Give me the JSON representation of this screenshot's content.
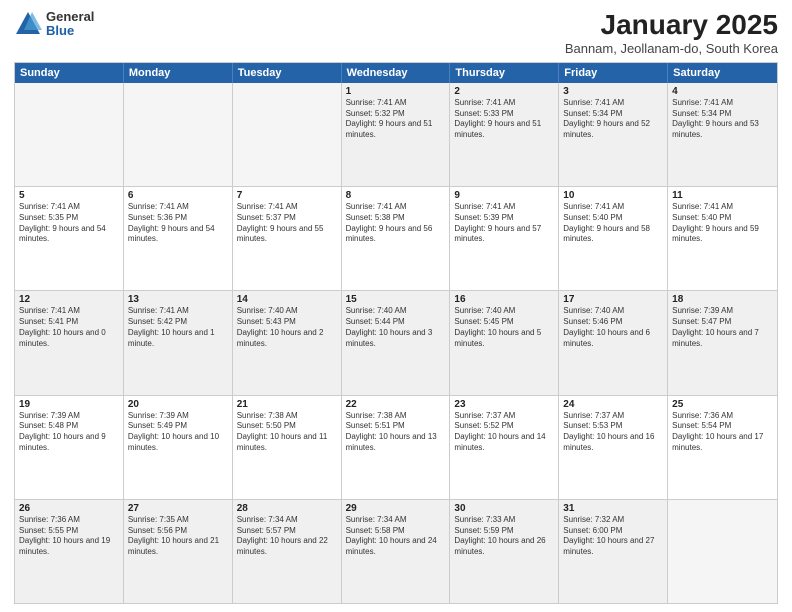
{
  "header": {
    "logo_general": "General",
    "logo_blue": "Blue",
    "title": "January 2025",
    "location": "Bannam, Jeollanam-do, South Korea"
  },
  "weekdays": [
    "Sunday",
    "Monday",
    "Tuesday",
    "Wednesday",
    "Thursday",
    "Friday",
    "Saturday"
  ],
  "rows": [
    [
      {
        "day": "",
        "empty": true
      },
      {
        "day": "",
        "empty": true
      },
      {
        "day": "",
        "empty": true
      },
      {
        "day": "1",
        "sunrise": "7:41 AM",
        "sunset": "5:32 PM",
        "daylight": "9 hours and 51 minutes."
      },
      {
        "day": "2",
        "sunrise": "7:41 AM",
        "sunset": "5:33 PM",
        "daylight": "9 hours and 51 minutes."
      },
      {
        "day": "3",
        "sunrise": "7:41 AM",
        "sunset": "5:34 PM",
        "daylight": "9 hours and 52 minutes."
      },
      {
        "day": "4",
        "sunrise": "7:41 AM",
        "sunset": "5:34 PM",
        "daylight": "9 hours and 53 minutes."
      }
    ],
    [
      {
        "day": "5",
        "sunrise": "7:41 AM",
        "sunset": "5:35 PM",
        "daylight": "9 hours and 54 minutes."
      },
      {
        "day": "6",
        "sunrise": "7:41 AM",
        "sunset": "5:36 PM",
        "daylight": "9 hours and 54 minutes."
      },
      {
        "day": "7",
        "sunrise": "7:41 AM",
        "sunset": "5:37 PM",
        "daylight": "9 hours and 55 minutes."
      },
      {
        "day": "8",
        "sunrise": "7:41 AM",
        "sunset": "5:38 PM",
        "daylight": "9 hours and 56 minutes."
      },
      {
        "day": "9",
        "sunrise": "7:41 AM",
        "sunset": "5:39 PM",
        "daylight": "9 hours and 57 minutes."
      },
      {
        "day": "10",
        "sunrise": "7:41 AM",
        "sunset": "5:40 PM",
        "daylight": "9 hours and 58 minutes."
      },
      {
        "day": "11",
        "sunrise": "7:41 AM",
        "sunset": "5:40 PM",
        "daylight": "9 hours and 59 minutes."
      }
    ],
    [
      {
        "day": "12",
        "sunrise": "7:41 AM",
        "sunset": "5:41 PM",
        "daylight": "10 hours and 0 minutes."
      },
      {
        "day": "13",
        "sunrise": "7:41 AM",
        "sunset": "5:42 PM",
        "daylight": "10 hours and 1 minute."
      },
      {
        "day": "14",
        "sunrise": "7:40 AM",
        "sunset": "5:43 PM",
        "daylight": "10 hours and 2 minutes."
      },
      {
        "day": "15",
        "sunrise": "7:40 AM",
        "sunset": "5:44 PM",
        "daylight": "10 hours and 3 minutes."
      },
      {
        "day": "16",
        "sunrise": "7:40 AM",
        "sunset": "5:45 PM",
        "daylight": "10 hours and 5 minutes."
      },
      {
        "day": "17",
        "sunrise": "7:40 AM",
        "sunset": "5:46 PM",
        "daylight": "10 hours and 6 minutes."
      },
      {
        "day": "18",
        "sunrise": "7:39 AM",
        "sunset": "5:47 PM",
        "daylight": "10 hours and 7 minutes."
      }
    ],
    [
      {
        "day": "19",
        "sunrise": "7:39 AM",
        "sunset": "5:48 PM",
        "daylight": "10 hours and 9 minutes."
      },
      {
        "day": "20",
        "sunrise": "7:39 AM",
        "sunset": "5:49 PM",
        "daylight": "10 hours and 10 minutes."
      },
      {
        "day": "21",
        "sunrise": "7:38 AM",
        "sunset": "5:50 PM",
        "daylight": "10 hours and 11 minutes."
      },
      {
        "day": "22",
        "sunrise": "7:38 AM",
        "sunset": "5:51 PM",
        "daylight": "10 hours and 13 minutes."
      },
      {
        "day": "23",
        "sunrise": "7:37 AM",
        "sunset": "5:52 PM",
        "daylight": "10 hours and 14 minutes."
      },
      {
        "day": "24",
        "sunrise": "7:37 AM",
        "sunset": "5:53 PM",
        "daylight": "10 hours and 16 minutes."
      },
      {
        "day": "25",
        "sunrise": "7:36 AM",
        "sunset": "5:54 PM",
        "daylight": "10 hours and 17 minutes."
      }
    ],
    [
      {
        "day": "26",
        "sunrise": "7:36 AM",
        "sunset": "5:55 PM",
        "daylight": "10 hours and 19 minutes."
      },
      {
        "day": "27",
        "sunrise": "7:35 AM",
        "sunset": "5:56 PM",
        "daylight": "10 hours and 21 minutes."
      },
      {
        "day": "28",
        "sunrise": "7:34 AM",
        "sunset": "5:57 PM",
        "daylight": "10 hours and 22 minutes."
      },
      {
        "day": "29",
        "sunrise": "7:34 AM",
        "sunset": "5:58 PM",
        "daylight": "10 hours and 24 minutes."
      },
      {
        "day": "30",
        "sunrise": "7:33 AM",
        "sunset": "5:59 PM",
        "daylight": "10 hours and 26 minutes."
      },
      {
        "day": "31",
        "sunrise": "7:32 AM",
        "sunset": "6:00 PM",
        "daylight": "10 hours and 27 minutes."
      },
      {
        "day": "",
        "empty": true
      }
    ]
  ]
}
